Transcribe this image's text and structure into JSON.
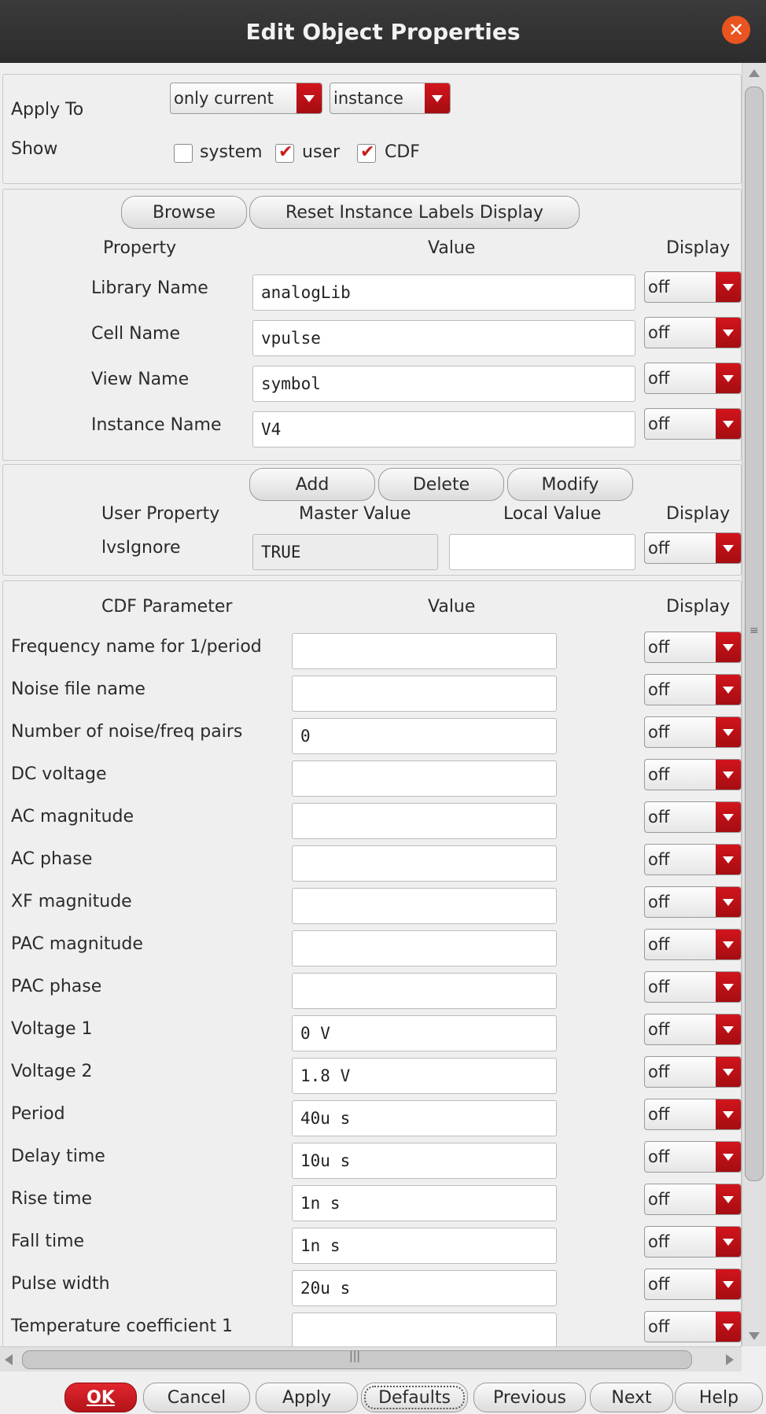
{
  "window": {
    "title": "Edit Object Properties"
  },
  "apply_section": {
    "apply_to_label": "Apply To",
    "apply_to_scope": "only current",
    "apply_to_type": "instance",
    "show_label": "Show",
    "show_options": [
      {
        "label": "system",
        "checked": false
      },
      {
        "label": "user",
        "checked": true
      },
      {
        "label": "CDF",
        "checked": true
      }
    ]
  },
  "instance_section": {
    "browse_button": "Browse",
    "reset_button": "Reset Instance Labels Display",
    "headers": {
      "property": "Property",
      "value": "Value",
      "display": "Display"
    },
    "rows": [
      {
        "label": "Library Name",
        "value": "analogLib",
        "display": "off"
      },
      {
        "label": "Cell Name",
        "value": "vpulse",
        "display": "off"
      },
      {
        "label": "View Name",
        "value": "symbol",
        "display": "off"
      },
      {
        "label": "Instance Name",
        "value": "V4",
        "display": "off"
      }
    ]
  },
  "user_section": {
    "add_button": "Add",
    "delete_button": "Delete",
    "modify_button": "Modify",
    "headers": {
      "property": "User Property",
      "master": "Master Value",
      "local": "Local Value",
      "display": "Display"
    },
    "rows": [
      {
        "label": "lvsIgnore",
        "master": "TRUE",
        "local": "",
        "display": "off"
      }
    ]
  },
  "cdf_section": {
    "headers": {
      "parameter": "CDF Parameter",
      "value": "Value",
      "display": "Display"
    },
    "rows": [
      {
        "label": "Frequency name for 1/period",
        "value": "",
        "display": "off"
      },
      {
        "label": "Noise file name",
        "value": "",
        "display": "off"
      },
      {
        "label": "Number of noise/freq pairs",
        "value": "0",
        "display": "off"
      },
      {
        "label": "DC voltage",
        "value": "",
        "display": "off"
      },
      {
        "label": "AC magnitude",
        "value": "",
        "display": "off"
      },
      {
        "label": "AC phase",
        "value": "",
        "display": "off"
      },
      {
        "label": "XF magnitude",
        "value": "",
        "display": "off"
      },
      {
        "label": "PAC magnitude",
        "value": "",
        "display": "off"
      },
      {
        "label": "PAC phase",
        "value": "",
        "display": "off"
      },
      {
        "label": "Voltage 1",
        "value": "0 V",
        "display": "off"
      },
      {
        "label": "Voltage 2",
        "value": "1.8 V",
        "display": "off"
      },
      {
        "label": "Period",
        "value": "40u s",
        "display": "off"
      },
      {
        "label": "Delay time",
        "value": "10u s",
        "display": "off"
      },
      {
        "label": "Rise time",
        "value": "1n s",
        "display": "off"
      },
      {
        "label": "Fall time",
        "value": "1n s",
        "display": "off"
      },
      {
        "label": "Pulse width",
        "value": "20u s",
        "display": "off"
      },
      {
        "label": "Temperature coefficient 1",
        "value": "",
        "display": "off"
      }
    ]
  },
  "footer": {
    "ok": "OK",
    "cancel": "Cancel",
    "apply": "Apply",
    "defaults": "Defaults",
    "previous": "Previous",
    "next": "Next",
    "help": "Help"
  },
  "colors": {
    "accent_red": "#c8141b",
    "title_bg": "#2c2c2c",
    "close_orange": "#e95420"
  }
}
